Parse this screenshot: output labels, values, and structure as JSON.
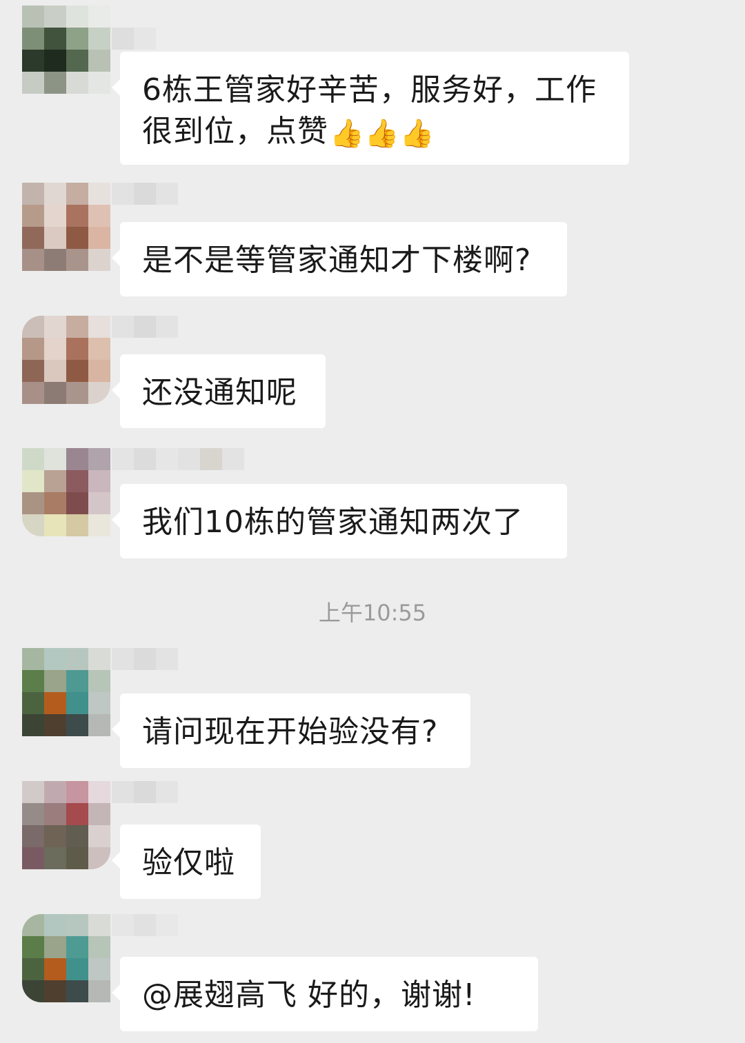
{
  "messages": [
    {
      "text": "6栋王管家好辛苦，服务好，工作很到位，点赞",
      "suffix": "👍👍👍"
    },
    {
      "text": "是不是等管家通知才下楼啊?",
      "suffix": ""
    },
    {
      "text": "还没通知呢",
      "suffix": ""
    },
    {
      "text": "我们10栋的管家通知两次了",
      "suffix": ""
    },
    {
      "text": "请问现在开始验没有?",
      "suffix": ""
    },
    {
      "text": "验仅啦",
      "suffix": ""
    },
    {
      "text": "@展翅高飞  好的，谢谢!",
      "suffix": ""
    }
  ],
  "timestamp": "上午10:55",
  "colors": {
    "background": "#ededed",
    "bubble": "#ffffff",
    "text": "#1a1a1a",
    "timestamp": "#9a9a9a",
    "thumbs": "#f3b32a"
  },
  "icons": {
    "avatar": "pixelated-avatar-icon",
    "thumbs_up": "thumbs-up-icon"
  }
}
